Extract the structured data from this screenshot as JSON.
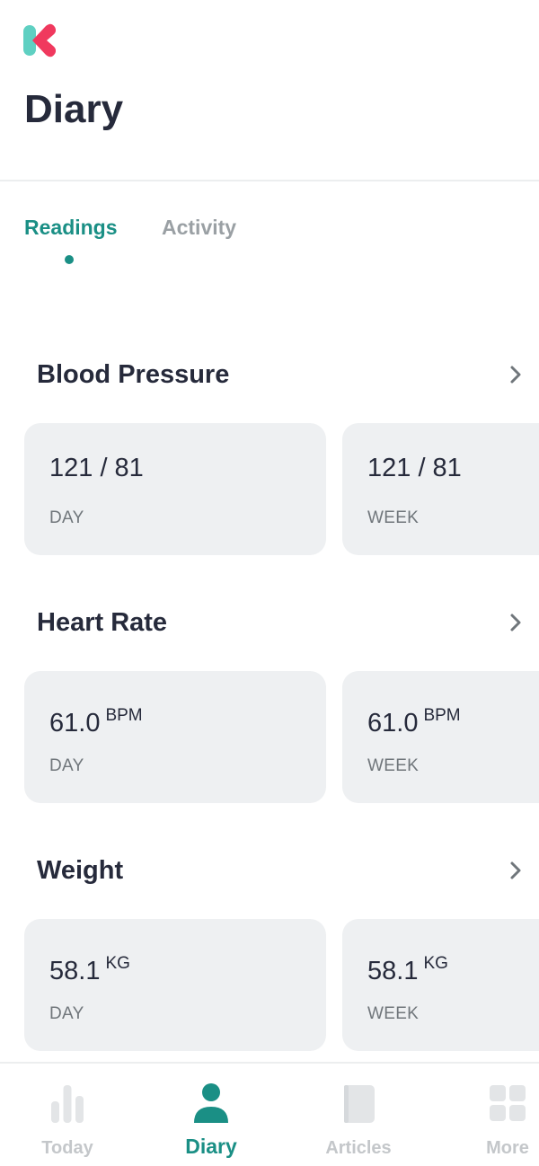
{
  "header": {
    "title": "Diary"
  },
  "tabs": [
    {
      "label": "Readings",
      "active": true
    },
    {
      "label": "Activity",
      "active": false
    }
  ],
  "sections": [
    {
      "title": "Blood Pressure",
      "cards": [
        {
          "value": "121 / 81",
          "unit": "",
          "period": "DAY"
        },
        {
          "value": "121 / 81",
          "unit": "",
          "period": "WEEK"
        }
      ]
    },
    {
      "title": "Heart Rate",
      "cards": [
        {
          "value": "61.0",
          "unit": "BPM",
          "period": "DAY"
        },
        {
          "value": "61.0",
          "unit": "BPM",
          "period": "WEEK"
        }
      ]
    },
    {
      "title": "Weight",
      "cards": [
        {
          "value": "58.1",
          "unit": "KG",
          "period": "DAY"
        },
        {
          "value": "58.1",
          "unit": "KG",
          "period": "WEEK"
        }
      ]
    }
  ],
  "bottom_nav": [
    {
      "label": "Today",
      "icon": "bar-chart-icon",
      "active": false
    },
    {
      "label": "Diary",
      "icon": "person-icon",
      "active": true
    },
    {
      "label": "Articles",
      "icon": "book-icon",
      "active": false
    },
    {
      "label": "More",
      "icon": "grid-icon",
      "active": false
    }
  ],
  "colors": {
    "accent": "#1a8f85",
    "brand_pink": "#f0395e",
    "brand_teal": "#5fd0c2",
    "card_bg": "#eef0f2",
    "text_dark": "#262a3b",
    "text_muted": "#9aa0a4"
  }
}
